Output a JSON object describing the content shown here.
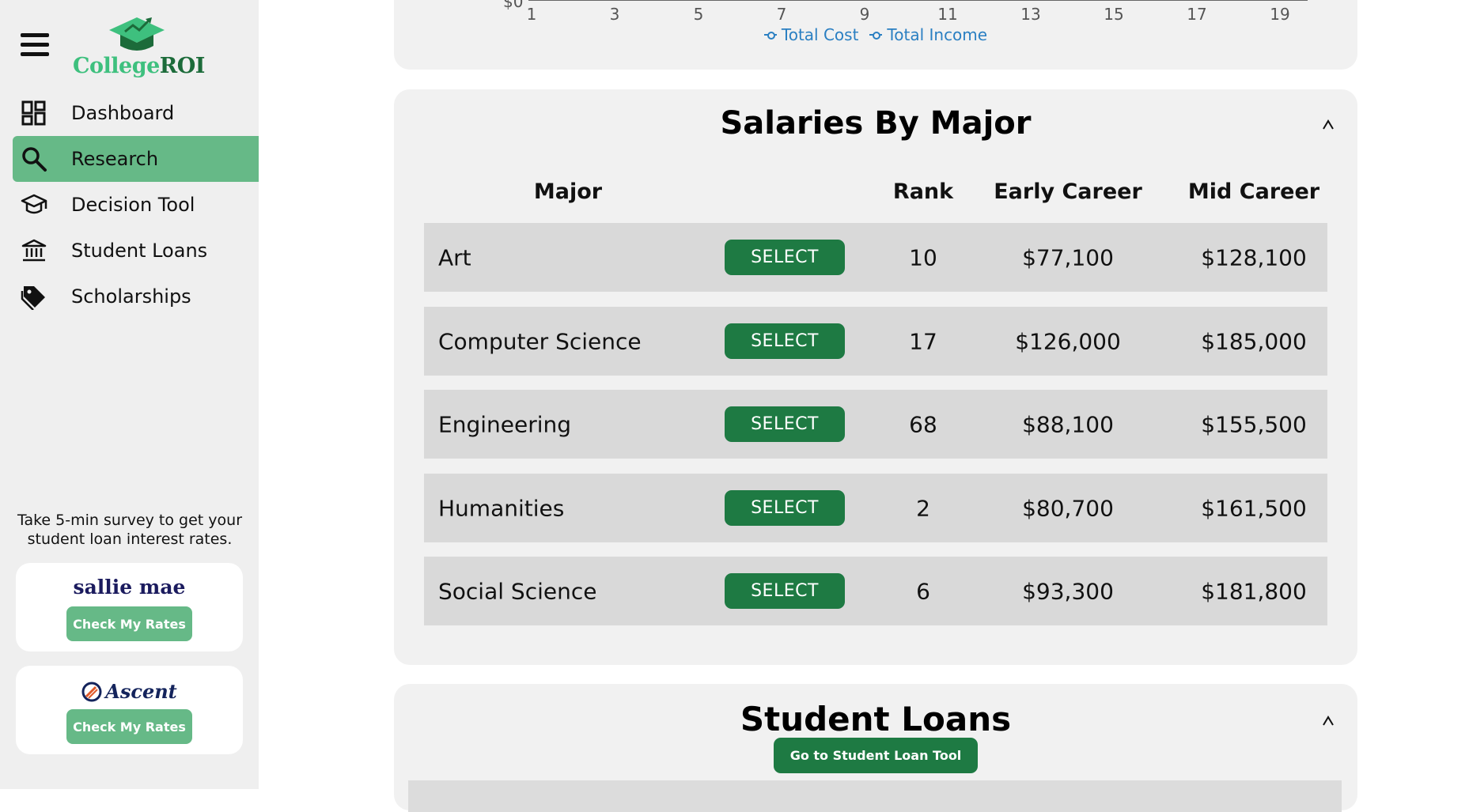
{
  "app": {
    "brand_part1": "College",
    "brand_part2": "ROI"
  },
  "sidebar": {
    "items": [
      {
        "label": "Dashboard",
        "icon": "dashboard-icon",
        "active": false
      },
      {
        "label": "Research",
        "icon": "search-icon",
        "active": true
      },
      {
        "label": "Decision Tool",
        "icon": "graduation-cap-icon",
        "active": false
      },
      {
        "label": "Student Loans",
        "icon": "bank-icon",
        "active": false
      },
      {
        "label": "Scholarships",
        "icon": "tag-icon",
        "active": false
      }
    ],
    "survey_text": "Take 5-min survey to get your student loan interest rates.",
    "promos": [
      {
        "brand": "sallie mae",
        "button": "Check My Rates"
      },
      {
        "brand": "Ascent",
        "button": "Check My Rates"
      }
    ]
  },
  "cost_chart": {
    "y_zero_label": "$0",
    "x_ticks": [
      "1",
      "3",
      "5",
      "7",
      "9",
      "11",
      "13",
      "15",
      "17",
      "19"
    ],
    "legend": [
      "Total Cost",
      "Total Income"
    ]
  },
  "salaries": {
    "title": "Salaries By Major",
    "columns": {
      "major": "Major",
      "rank": "Rank",
      "early": "Early Career",
      "mid": "Mid Career"
    },
    "select_label": "SELECT",
    "rows": [
      {
        "major": "Art",
        "rank": "10",
        "early": "$77,100",
        "mid": "$128,100"
      },
      {
        "major": "Computer Science",
        "rank": "17",
        "early": "$126,000",
        "mid": "$185,000"
      },
      {
        "major": "Engineering",
        "rank": "68",
        "early": "$88,100",
        "mid": "$155,500"
      },
      {
        "major": "Humanities",
        "rank": "2",
        "early": "$80,700",
        "mid": "$161,500"
      },
      {
        "major": "Social Science",
        "rank": "6",
        "early": "$93,300",
        "mid": "$181,800"
      }
    ]
  },
  "loans": {
    "title": "Student Loans",
    "button": "Go to Student Loan Tool"
  },
  "colors": {
    "accent_green": "#66b987",
    "button_green": "#1e7a43",
    "legend_blue": "#2a7fc2",
    "brand_light": "#3ec07e",
    "brand_dark": "#1c6b3a"
  }
}
